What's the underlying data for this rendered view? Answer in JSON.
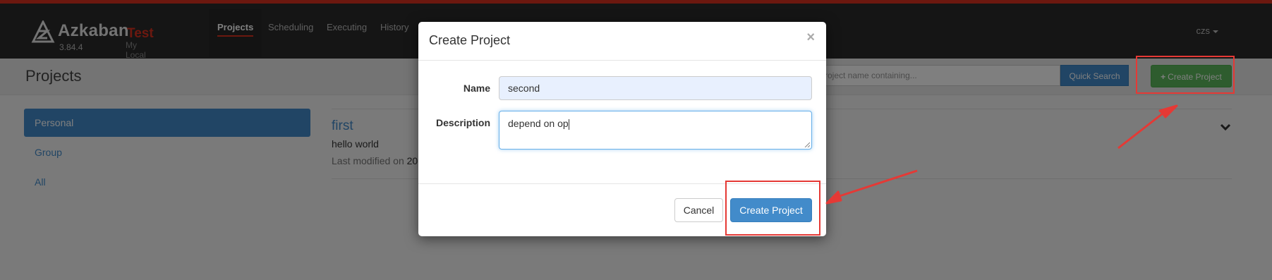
{
  "app": {
    "name": "Azkaban",
    "environment": "Test",
    "version": "3.84.4",
    "subtitle": "My Local Azkaban"
  },
  "nav": {
    "items": [
      {
        "label": "Projects",
        "active": true
      },
      {
        "label": "Scheduling"
      },
      {
        "label": "Executing"
      },
      {
        "label": "History"
      }
    ],
    "user": "czs"
  },
  "header": {
    "title": "Projects",
    "search_placeholder": "Project name containing...",
    "quick_search_label": "Quick Search",
    "create_project_label": "Create Project"
  },
  "sidenav": {
    "items": [
      {
        "label": "Personal",
        "active": true
      },
      {
        "label": "Group"
      },
      {
        "label": "All"
      }
    ]
  },
  "projects": [
    {
      "name": "first",
      "description": "hello world",
      "modified_prefix": "Last modified on",
      "modified_value": "20"
    }
  ],
  "modal": {
    "title": "Create Project",
    "close_glyph": "×",
    "name_label": "Name",
    "name_value": "second",
    "description_label": "Description",
    "description_value": "depend on op",
    "cancel_label": "Cancel",
    "submit_label": "Create Project"
  },
  "colors": {
    "brand_red": "#d9301e",
    "primary": "#428bca",
    "success": "#5cb85c",
    "annotation": "#e53935"
  }
}
